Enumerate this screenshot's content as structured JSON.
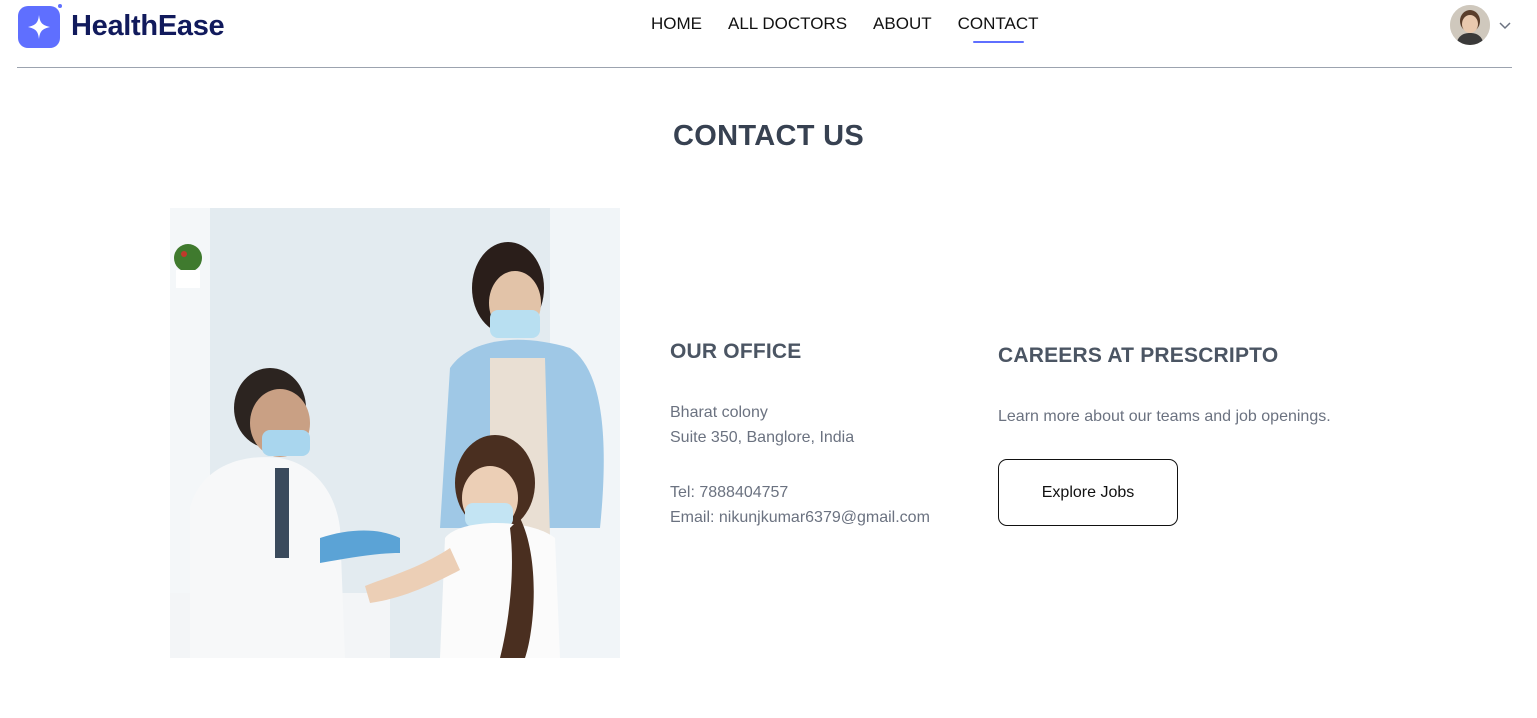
{
  "brand": {
    "name": "HealthEase",
    "accent": "#5f6fff",
    "logo_color": "#111a5c"
  },
  "nav": {
    "items": [
      {
        "label": "HOME"
      },
      {
        "label": "ALL DOCTORS"
      },
      {
        "label": "ABOUT"
      },
      {
        "label": "CONTACT"
      }
    ],
    "active": "CONTACT"
  },
  "profile": {
    "avatar_icon": "user-avatar",
    "dropdown_icon": "chevron-down-icon"
  },
  "page": {
    "title": "CONTACT US"
  },
  "office": {
    "title": "OUR OFFICE",
    "address_line1": "Bharat colony",
    "address_line2": "Suite 350, Banglore, India",
    "tel": "Tel: 7888404757",
    "email": "Email: nikunjkumar6379@gmail.com"
  },
  "careers": {
    "title": "CAREERS AT PRESCRIPTO",
    "description": "Learn more about our teams and job openings.",
    "button_label": "Explore Jobs"
  }
}
